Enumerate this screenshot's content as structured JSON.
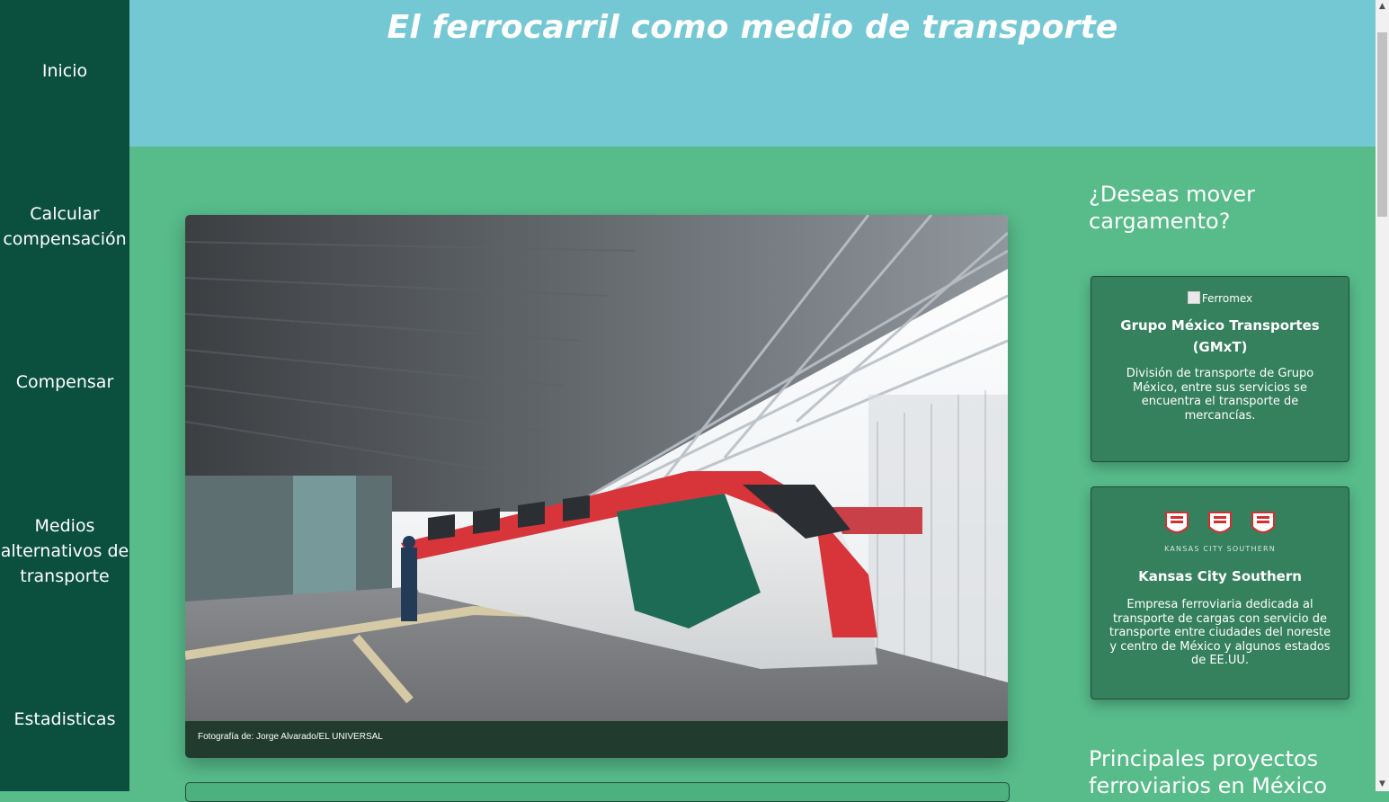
{
  "sidebar": {
    "items": [
      {
        "label": "Inicio"
      },
      {
        "label": "Calcular compensación"
      },
      {
        "label": "Compensar"
      },
      {
        "label": "Medios alternativos de transporte"
      },
      {
        "label": "Estadisticas"
      }
    ]
  },
  "header": {
    "title": "El ferrocarril como medio de transporte"
  },
  "main": {
    "photo_caption": "Fotografía de: Jorge Alvarado/EL UNIVERSAL"
  },
  "aside": {
    "heading1": "¿Deseas mover cargamento?",
    "cards": [
      {
        "logo_alt": "Ferromex",
        "name": "Grupo México Transportes (GMxT)",
        "description": "División de transporte de Grupo México, entre sus servicios se encuentra el transporte de mercancías."
      },
      {
        "logo_text": "KANSAS CITY SOUTHERN",
        "name": "Kansas City Southern",
        "description": "Empresa ferroviaria dedicada al transporte de cargas con servicio de transporte entre ciudades del noreste y centro de México y algunos estados de EE.UU."
      }
    ],
    "heading2": "Principales proyectos ferroviarios en México"
  },
  "colors": {
    "sidebar": "#0b4f3f",
    "header": "#74c8d3",
    "page": "#57bb8a",
    "card": "#35805d",
    "train_red": "#d8353b",
    "train_green": "#1e6b55"
  },
  "icons": [
    "broken-image-icon",
    "kcs-logo-icon",
    "scroll-up-arrow-icon",
    "scroll-down-arrow-icon"
  ]
}
